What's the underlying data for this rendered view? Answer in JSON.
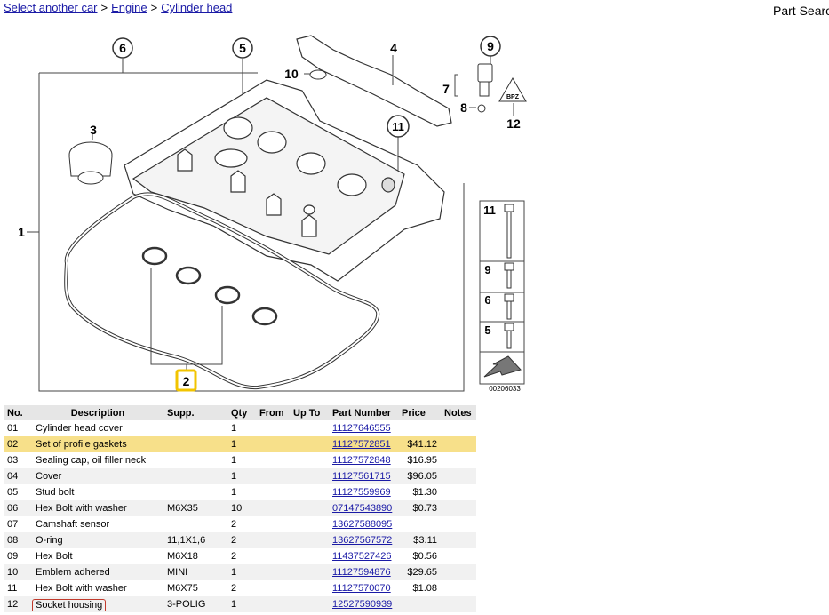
{
  "breadcrumb": {
    "items": [
      {
        "label": "Select another car"
      },
      {
        "label": "Engine"
      },
      {
        "label": "Cylinder head"
      }
    ],
    "separator": ">"
  },
  "part_search": {
    "label": "Part Search"
  },
  "diagram": {
    "image_number": "00206033",
    "callouts": [
      "1",
      "2",
      "3",
      "4",
      "5",
      "6",
      "7",
      "8",
      "9",
      "10",
      "11",
      "12"
    ],
    "bolt_legend": [
      "11",
      "9",
      "6",
      "5"
    ],
    "badge_text": "BPZ",
    "highlight_color": "#f2c400"
  },
  "table": {
    "headers": {
      "no": "No.",
      "description": "Description",
      "supp": "Supp.",
      "qty": "Qty",
      "from": "From",
      "up_to": "Up To",
      "part_number": "Part Number",
      "price": "Price",
      "notes": "Notes"
    },
    "rows": [
      {
        "no": "01",
        "description": "Cylinder head cover",
        "supp": "",
        "qty": "1",
        "from": "",
        "up_to": "",
        "part_number": "11127646555",
        "price": "",
        "notes": ""
      },
      {
        "no": "02",
        "description": "Set of profile gaskets",
        "supp": "",
        "qty": "1",
        "from": "",
        "up_to": "",
        "part_number": "11127572851",
        "price": "$41.12",
        "notes": ""
      },
      {
        "no": "03",
        "description": "Sealing cap, oil filler neck",
        "supp": "",
        "qty": "1",
        "from": "",
        "up_to": "",
        "part_number": "11127572848",
        "price": "$16.95",
        "notes": ""
      },
      {
        "no": "04",
        "description": "Cover",
        "supp": "",
        "qty": "1",
        "from": "",
        "up_to": "",
        "part_number": "11127561715",
        "price": "$96.05",
        "notes": ""
      },
      {
        "no": "05",
        "description": "Stud bolt",
        "supp": "",
        "qty": "1",
        "from": "",
        "up_to": "",
        "part_number": "11127559969",
        "price": "$1.30",
        "notes": ""
      },
      {
        "no": "06",
        "description": "Hex Bolt with washer",
        "supp": "M6X35",
        "qty": "10",
        "from": "",
        "up_to": "",
        "part_number": "07147543890",
        "price": "$0.73",
        "notes": ""
      },
      {
        "no": "07",
        "description": "Camshaft sensor",
        "supp": "",
        "qty": "2",
        "from": "",
        "up_to": "",
        "part_number": "13627588095",
        "price": "",
        "notes": ""
      },
      {
        "no": "08",
        "description": "O-ring",
        "supp": "11,1X1,6",
        "qty": "2",
        "from": "",
        "up_to": "",
        "part_number": "13627567572",
        "price": "$3.11",
        "notes": ""
      },
      {
        "no": "09",
        "description": "Hex Bolt",
        "supp": "M6X18",
        "qty": "2",
        "from": "",
        "up_to": "",
        "part_number": "11437527426",
        "price": "$0.56",
        "notes": ""
      },
      {
        "no": "10",
        "description": "Emblem adhered",
        "supp": "MINI",
        "qty": "1",
        "from": "",
        "up_to": "",
        "part_number": "11127594876",
        "price": "$29.65",
        "notes": ""
      },
      {
        "no": "11",
        "description": "Hex Bolt with washer",
        "supp": "M6X75",
        "qty": "2",
        "from": "",
        "up_to": "",
        "part_number": "11127570070",
        "price": "$1.08",
        "notes": ""
      },
      {
        "no": "12",
        "description": "Socket housing",
        "supp": "3-POLIG",
        "qty": "1",
        "from": "",
        "up_to": "",
        "part_number": "12527590939",
        "price": "",
        "notes": ""
      }
    ],
    "highlight_color": "#f7e08a"
  }
}
